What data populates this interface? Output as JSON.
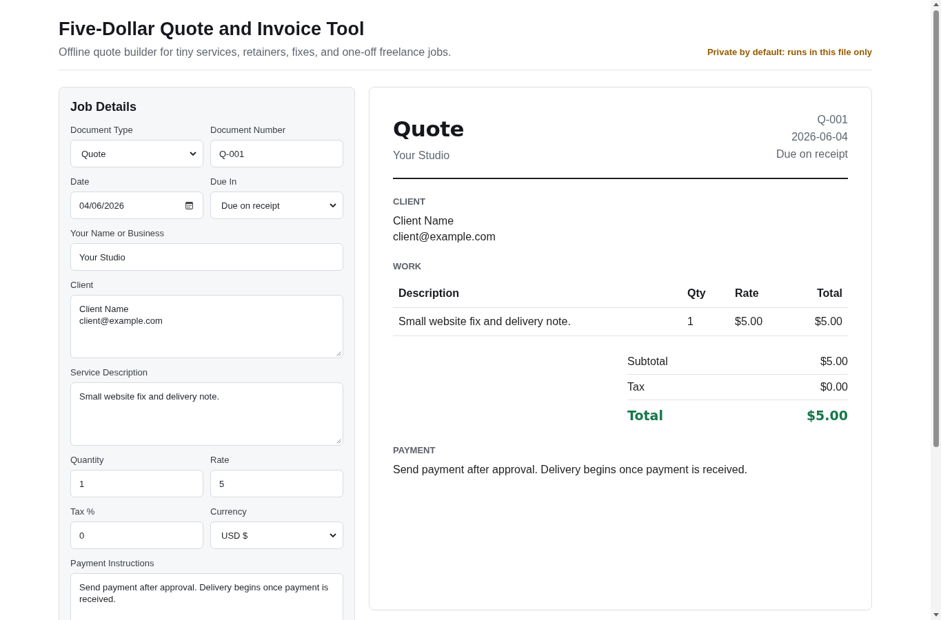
{
  "header": {
    "title": "Five-Dollar Quote and Invoice Tool",
    "subtitle": "Offline quote builder for tiny services, retainers, fixes, and one-off freelance jobs.",
    "privacy_note": "Private by default: runs in this file only"
  },
  "form": {
    "title": "Job Details",
    "rows": [
      [
        {
          "kind": "select",
          "label": "Document Type",
          "value": "Quote"
        },
        {
          "kind": "text",
          "label": "Document Number",
          "value": "Q-001"
        }
      ],
      [
        {
          "kind": "date",
          "label": "Date",
          "value": "04/06/2026"
        },
        {
          "kind": "select",
          "label": "Due In",
          "value": "Due on receipt"
        }
      ],
      [
        {
          "kind": "text",
          "label": "Your Name or Business",
          "value": "Your Studio"
        }
      ],
      [
        {
          "kind": "textarea",
          "label": "Client",
          "value": "Client Name\nclient@example.com"
        }
      ],
      [
        {
          "kind": "textarea",
          "label": "Service Description",
          "value": "Small website fix and delivery note."
        }
      ],
      [
        {
          "kind": "text",
          "label": "Quantity",
          "value": "1"
        },
        {
          "kind": "text",
          "label": "Rate",
          "value": "5"
        }
      ],
      [
        {
          "kind": "text",
          "label": "Tax %",
          "value": "0"
        },
        {
          "kind": "select",
          "label": "Currency",
          "value": "USD $"
        }
      ],
      [
        {
          "kind": "textarea",
          "label": "Payment Instructions",
          "value": "Send payment after approval. Delivery begins once payment is received."
        }
      ]
    ]
  },
  "preview": {
    "doc_type": "Quote",
    "business": "Your Studio",
    "number": "Q-001",
    "date": "2026-06-04",
    "due": "Due on receipt",
    "client": {
      "heading": "CLIENT",
      "name": "Client Name",
      "email": "client@example.com"
    },
    "work": {
      "heading": "WORK",
      "columns": [
        "Description",
        "Qty",
        "Rate",
        "Total"
      ],
      "rows": [
        [
          "Small website fix and delivery note.",
          "1",
          "$5.00",
          "$5.00"
        ]
      ]
    },
    "totals": [
      {
        "kind": "line",
        "label": "Subtotal",
        "value": "$5.00"
      },
      {
        "kind": "line",
        "label": "Tax",
        "value": "$0.00"
      },
      {
        "kind": "grand",
        "label": "Total",
        "value": "$5.00"
      }
    ],
    "payment": {
      "heading": "PAYMENT",
      "text": "Send payment after approval. Delivery begins once payment is received."
    }
  }
}
